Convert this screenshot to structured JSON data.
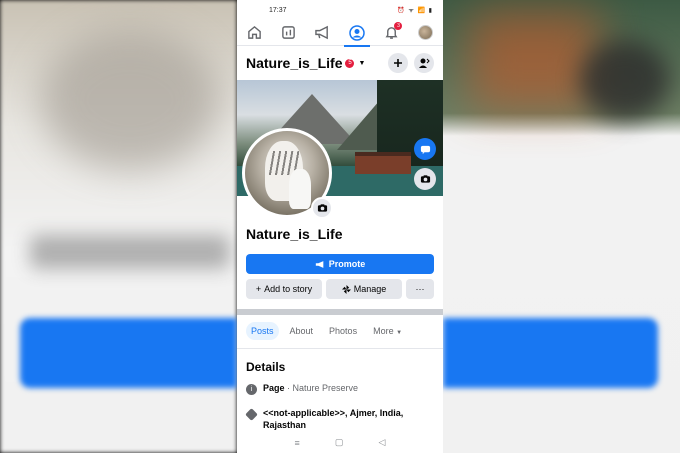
{
  "status_bar": {
    "time": "17:37",
    "icons": "⏰ ᯤ 📶 ▮"
  },
  "top_tabs": {
    "notification_badge": "3"
  },
  "header": {
    "page_name": "Nature_is_Life",
    "badge": "5"
  },
  "profile": {
    "name": "Nature_is_Life"
  },
  "actions": {
    "promote": "Promote",
    "add_to_story": "Add to story",
    "manage": "Manage",
    "more": "···"
  },
  "subtabs": {
    "posts": "Posts",
    "about": "About",
    "photos": "Photos",
    "more": "More"
  },
  "details": {
    "heading": "Details",
    "category_label": "Page",
    "category_value": " · Nature Preserve",
    "address_line1": "<<not-applicable>>, Ajmer, India,",
    "address_line2": "Rajasthan"
  },
  "system_nav": {
    "menu": "≡",
    "home": "▢",
    "back": "◁"
  },
  "colors": {
    "accent": "#1877f2",
    "badge": "#e41e3f"
  }
}
